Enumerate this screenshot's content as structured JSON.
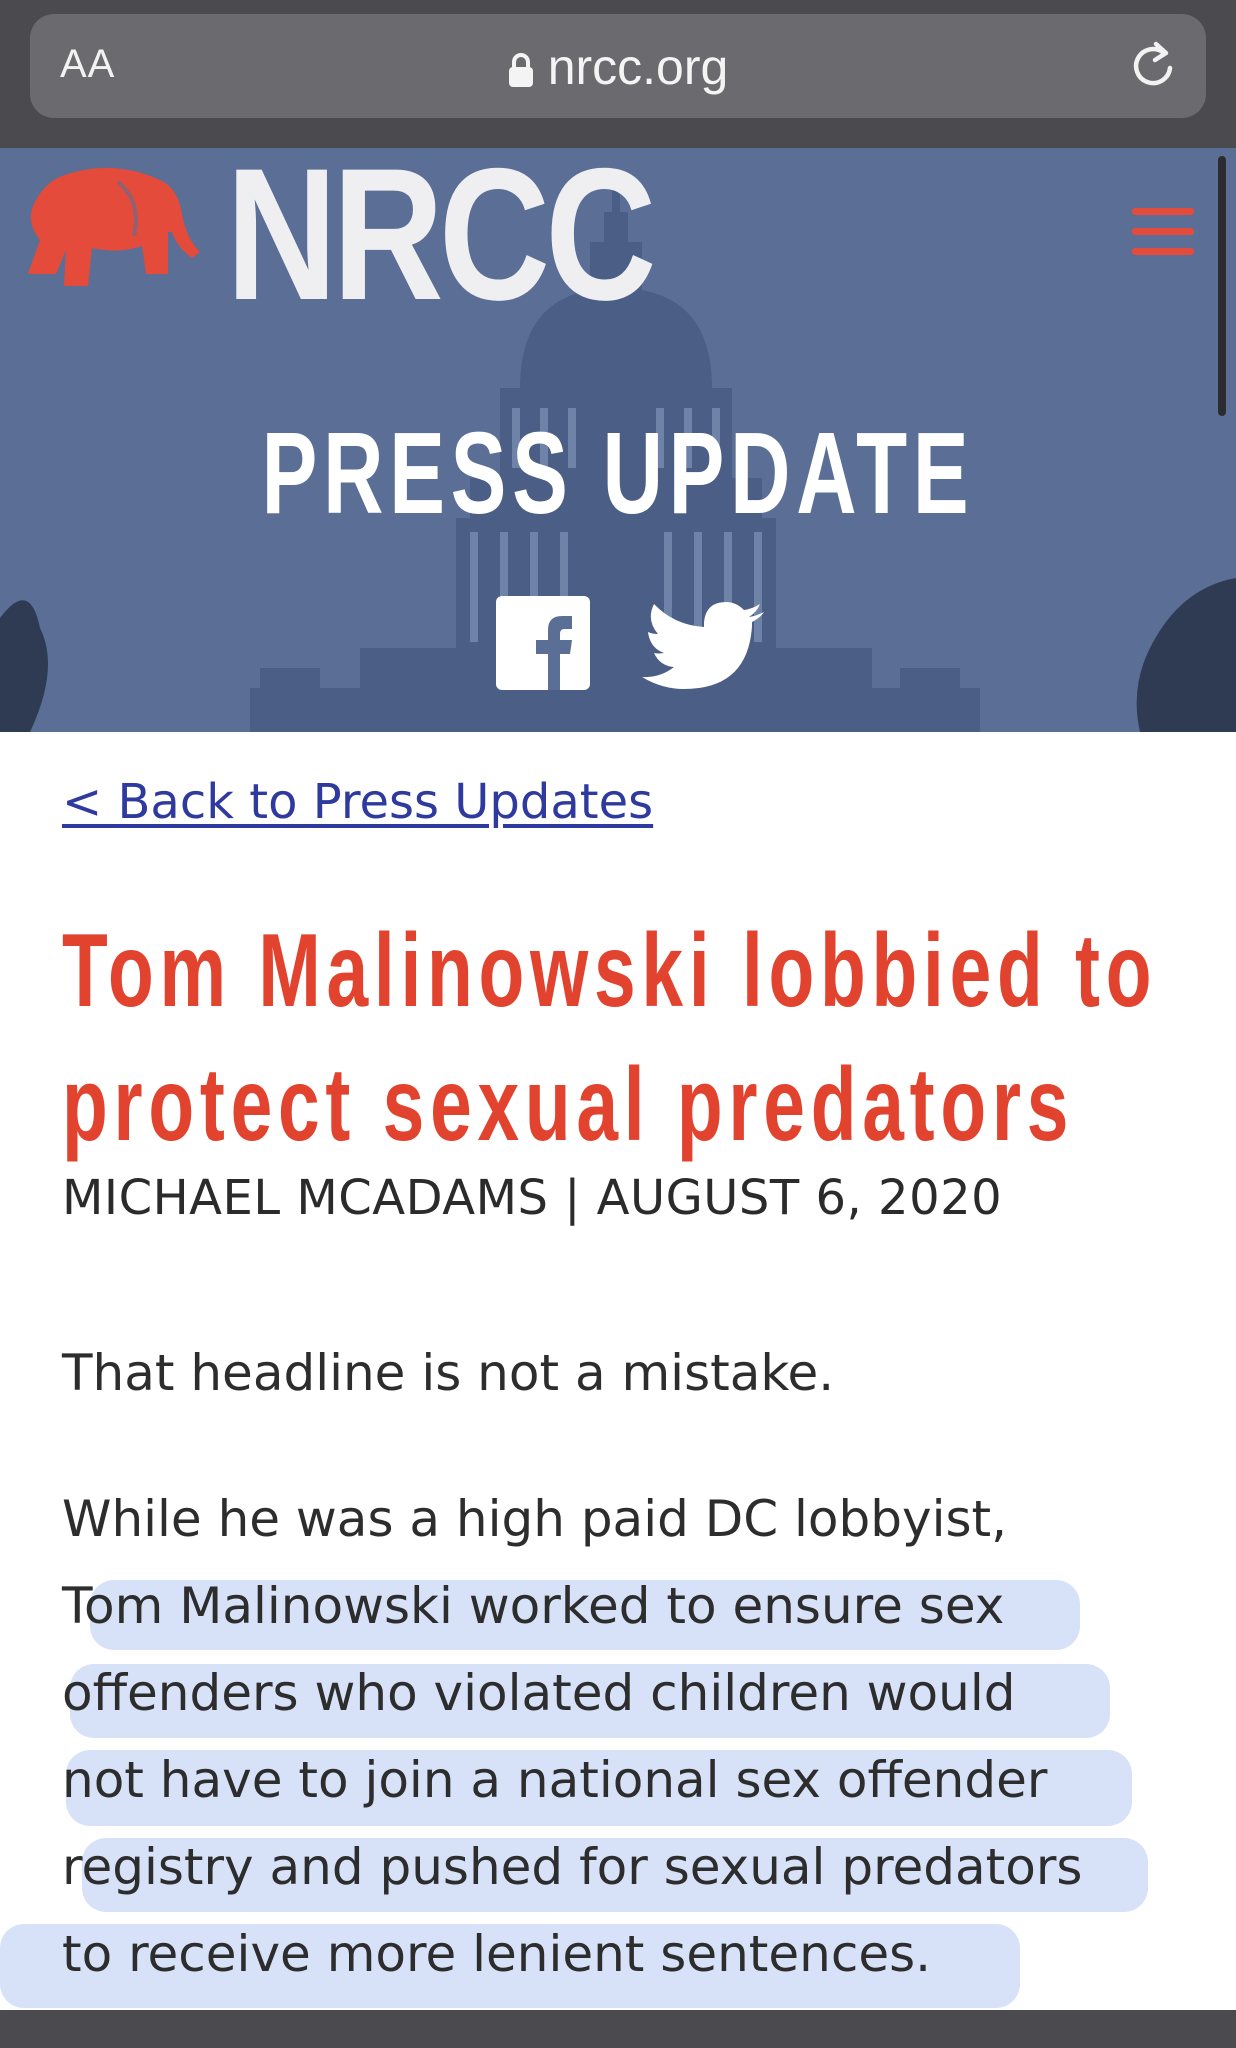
{
  "browser": {
    "text_size_label": "AA",
    "url": "nrcc.org"
  },
  "site": {
    "logo_text": "NRCC",
    "section_title": "PRESS UPDATE"
  },
  "article": {
    "back_link": "< Back to Press Updates",
    "headline_line1": "Tom Malinowski lobbied to",
    "headline_line2": "protect sexual predators",
    "byline": "MICHAEL MCADAMS | AUGUST 6, 2020",
    "paragraph1": "That headline is not a mistake.",
    "paragraph2_lines": [
      "While he was a high paid DC lobbyist,",
      "Tom Malinowski worked to ensure sex",
      "offenders who violated children would",
      "not have to join a national sex offender",
      "registry and pushed for sexual predators",
      "to receive more lenient sentences."
    ]
  },
  "colors": {
    "brand_red": "#e2432f",
    "hero_blue": "#5a6e96",
    "link_blue": "#2f3a9e",
    "highlight": "#96b2ee"
  },
  "icons": [
    "lock-icon",
    "reload-icon",
    "elephant-logo-icon",
    "menu-icon",
    "facebook-icon",
    "twitter-icon"
  ]
}
